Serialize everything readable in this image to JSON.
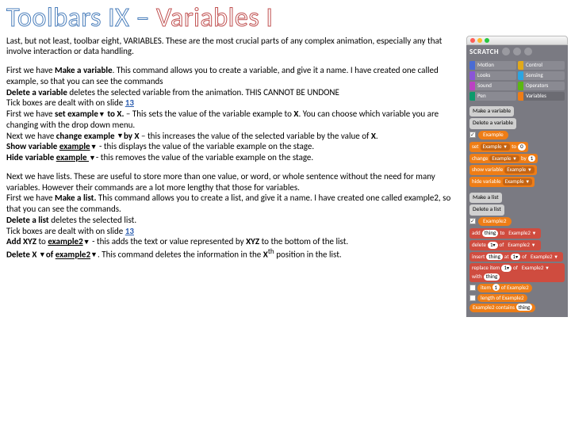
{
  "title": {
    "part1": "Toolbars IX – ",
    "part2": "Variables I"
  },
  "intro": "Last, but not least, toolbar eight, VARIABLES.  These are the most crucial parts of any complex animation, especially any that involve interaction or data handling.",
  "variables_para": {
    "l1a": "First we have ",
    "l1b": "Make a variable",
    "l1c": ".  This command allows you to create a variable, and give it a name.  I have created one called example, so that you can see the commands",
    "l2a": "Delete a variable ",
    "l2b": "deletes the selected variable from the animation.  THIS CANNOT BE UNDONE",
    "l3a": "Tick boxes are dealt with on slide ",
    "l3link": "13",
    "l4a": "First we have ",
    "l4b": "set example",
    "l4c": " to X.",
    "l4d": " – This sets the value of the variable example to ",
    "l4e": "X",
    "l4f": ".  You can choose which variable you are changing with the drop down menu.",
    "l5a": "Next we have ",
    "l5b": "change example ",
    "l5c": "by X ",
    "l5d": "– this increases the value of the selected variable by the value of ",
    "l5e": "X",
    "l5f": ".",
    "l6a": " Show variable ",
    "l6b": "example",
    "l6c": " - this displays the value of the variable example on the stage.",
    "l7a": " Hide variable ",
    "l7b": "example ",
    "l7c": "- this removes the value of the variable example on the stage."
  },
  "lists_para": {
    "l1": "Next we have lists.  These are useful to store  more than one value, or word, or whole sentence without the need for many variables.  However their commands are a lot more lengthy that those for variables.",
    "l2a": "First we have ",
    "l2b": "Make a list.  ",
    "l2c": "This command allows you to create a list, and give it a name.  I have created one called example2, so that you can see the commands.",
    "l3a": "Delete a list ",
    "l3b": "deletes the selected list.",
    "l4a": "Tick boxes are dealt with on slide ",
    "l4link": "13",
    "l5a": "Add ",
    "l5b": "XYZ ",
    "l5c": "to ",
    "l5d": "example2",
    "l5e": " - this adds the text or value represented by ",
    "l5f": "XYZ",
    "l5g": " to the bottom of the list.",
    "l6a": "Delete ",
    "l6b": "X ",
    "l6c": "of ",
    "l6d": "example2",
    "l6e": ".  This command deletes the information in the ",
    "l6f": "X",
    "l6g": "th",
    "l6h": " position in the list."
  },
  "sidebar": {
    "logo": "SCRATCH",
    "palette": {
      "motion": "Motion",
      "control": "Control",
      "looks": "Looks",
      "sensing": "Sensing",
      "sound": "Sound",
      "operators": "Operators",
      "pen": "Pen",
      "variables": "Variables"
    },
    "make_var": "Make a variable",
    "del_var": "Delete a variable",
    "example": "Example",
    "set_block": {
      "a": "set",
      "b": "Example",
      "c": "to",
      "d": "0"
    },
    "change_block": {
      "a": "change",
      "b": "Example",
      "c": "by",
      "d": "1"
    },
    "show_block": {
      "a": "show variable",
      "b": "Example"
    },
    "hide_block": {
      "a": "hide variable",
      "b": "Example"
    },
    "make_list": "Make a list",
    "del_list": "Delete a list",
    "example2": "Example2",
    "add_block": {
      "a": "add",
      "b": "thing",
      "c": "to",
      "d": "Example2"
    },
    "delete_block": {
      "a": "delete",
      "b": "1",
      "c": "of",
      "d": "Example2"
    },
    "insert_block": {
      "a": "insert",
      "b": "thing",
      "c": "at",
      "d": "1",
      "e": "of",
      "f": "Example2"
    },
    "replace_block": {
      "a": "replace item",
      "b": "1",
      "c": "of",
      "d": "Example2",
      "e": "with",
      "f": "thing"
    },
    "reporters": {
      "item": {
        "a": "item",
        "b": "1",
        "c": "of",
        "d": "Example2"
      },
      "length": {
        "a": "length of",
        "b": "Example2"
      },
      "contains": {
        "a": "Example2",
        "b": "contains",
        "c": "thing"
      }
    }
  }
}
